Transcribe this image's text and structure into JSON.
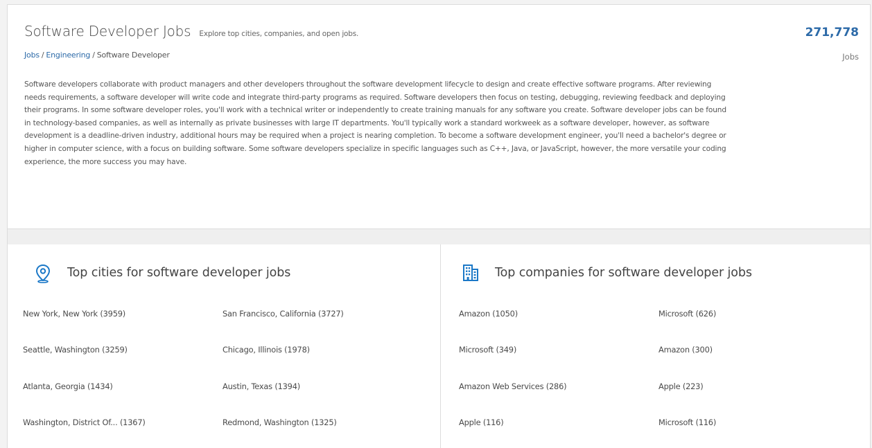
{
  "header": {
    "title": "Software Developer Jobs",
    "subtitle": "Explore top cities, companies, and open jobs.",
    "breadcrumb": [
      "Jobs",
      "Engineering",
      "Software Developer"
    ],
    "job_count": "271,778",
    "job_count_label": "Jobs",
    "description": "Software developers collaborate with product managers and other developers throughout the software development lifecycle to design and create effective software programs. After reviewing needs requirements, a software developer will write code and integrate third-party programs as required. Software developers then focus on testing, debugging, reviewing feedback and deploying their programs. In some software developer roles, you'll work with a technical writer or independently to create training manuals for any software you create. Software developer jobs can be found in technology-based companies, as well as internally as private businesses with large IT departments. You'll typically work a standard workweek as a software developer, however, as software development is a deadline-driven industry, additional hours may be required when a project is nearing completion. To become a software development engineer, you'll need a bachelor's degree or higher in computer science, with a focus on building software. Some software developers specialize in specific languages such as C++, Java, or JavaScript, however, the more versatile your coding experience, the more success you may have."
  },
  "cities": {
    "icon": "location-pin-icon",
    "title": "Top cities for software developer jobs",
    "items": [
      "New York, New York (3959)",
      "San Francisco, California (3727)",
      "Seattle, Washington (3259)",
      "Chicago, Illinois (1978)",
      "Atlanta, Georgia (1434)",
      "Austin, Texas (1394)",
      "Washington, District Of... (1367)",
      "Redmond, Washington (1325)"
    ]
  },
  "companies": {
    "icon": "building-icon",
    "title": "Top companies for software developer jobs",
    "items": [
      "Amazon (1050)",
      "Microsoft (626)",
      "Microsoft (349)",
      "Amazon (300)",
      "Amazon Web Services (286)",
      "Apple (223)",
      "Apple (116)",
      "Microsoft (116)"
    ]
  },
  "colors": {
    "accent": "#2c6aa8",
    "icon_blue": "#1b78c7"
  }
}
